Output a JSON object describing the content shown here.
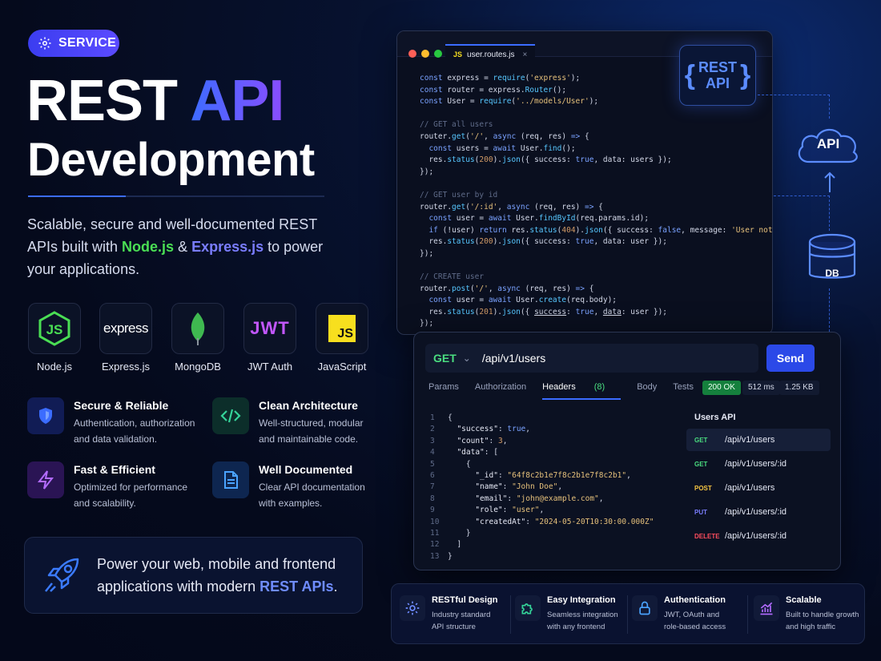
{
  "badge": {
    "label": "SERVICE"
  },
  "hero": {
    "line1_a": "REST ",
    "line1_b": "API",
    "line2": "Development"
  },
  "description": {
    "part1": "Scalable, secure and well-documented REST APIs built with ",
    "node": "Node.js",
    "amp": " & ",
    "express": "Express.js",
    "part2": " to power your applications."
  },
  "tech": [
    {
      "label": "Node.js",
      "icon": "nodejs-icon"
    },
    {
      "label": "Express.js",
      "icon": "express-icon",
      "logo_text": "express"
    },
    {
      "label": "MongoDB",
      "icon": "mongodb-icon"
    },
    {
      "label": "JWT Auth",
      "icon": "jwt-icon",
      "logo_text": "JWT"
    },
    {
      "label": "JavaScript",
      "icon": "javascript-icon",
      "logo_text": "JS"
    }
  ],
  "features": [
    {
      "title": "Secure & Reliable",
      "desc1": "Authentication, authorization",
      "desc2": "and data validation.",
      "icon": "shield-icon"
    },
    {
      "title": "Clean Architecture",
      "desc1": "Well-structured, modular",
      "desc2": "and maintainable code.",
      "icon": "code-icon"
    },
    {
      "title": "Fast & Efficient",
      "desc1": "Optimized for performance",
      "desc2": "and scalability.",
      "icon": "lightning-icon"
    },
    {
      "title": "Well Documented",
      "desc1": "Clear API documentation",
      "desc2": "with examples.",
      "icon": "document-icon"
    }
  ],
  "power": {
    "part1": "Power your web, mobile and frontend",
    "part2": "applications with modern ",
    "highlight": "REST APIs",
    "end": "."
  },
  "editor": {
    "filename": "user.routes.js",
    "file_badge": "JS",
    "close": "×"
  },
  "rest_logo": {
    "left": "{",
    "right": "}",
    "w1": "REST",
    "w2": "API"
  },
  "diagram": {
    "cloud_label": "API",
    "db_label": "DB"
  },
  "request": {
    "method": "GET",
    "url": "/api/v1/users",
    "send": "Send"
  },
  "tabs": [
    {
      "label": "Params"
    },
    {
      "label": "Authorization"
    },
    {
      "label": "Headers",
      "count": "(8)"
    },
    {
      "label": "Body"
    },
    {
      "label": "Tests"
    }
  ],
  "status": {
    "code": "200 OK",
    "time": "512 ms",
    "size": "1.25 KB"
  },
  "endpoints": {
    "header": "Users API",
    "items": [
      {
        "method": "GET",
        "path": "/api/v1/users",
        "color": "#4ade80"
      },
      {
        "method": "GET",
        "path": "/api/v1/users/:id",
        "color": "#4ade80"
      },
      {
        "method": "POST",
        "path": "/api/v1/users",
        "color": "#f5c542"
      },
      {
        "method": "PUT",
        "path": "/api/v1/users/:id",
        "color": "#7a7dff"
      },
      {
        "method": "DELETE",
        "path": "/api/v1/users/:id",
        "color": "#ff4d5e"
      }
    ]
  },
  "strip": [
    {
      "title": "RESTful Design",
      "d1": "Industry standard",
      "d2": "API structure",
      "icon": "gear-icon"
    },
    {
      "title": "Easy Integration",
      "d1": "Seamless integration",
      "d2": "with any frontend",
      "icon": "puzzle-icon"
    },
    {
      "title": "Authentication",
      "d1": "JWT, OAuth and",
      "d2": "role-based access",
      "icon": "lock-icon"
    },
    {
      "title": "Scalable",
      "d1": "Built to handle growth",
      "d2": "and high traffic",
      "icon": "growth-chart-icon"
    }
  ],
  "colors": {
    "accent": "#3b6cff",
    "green": "#4ade80",
    "purple": "#8a4dff"
  }
}
